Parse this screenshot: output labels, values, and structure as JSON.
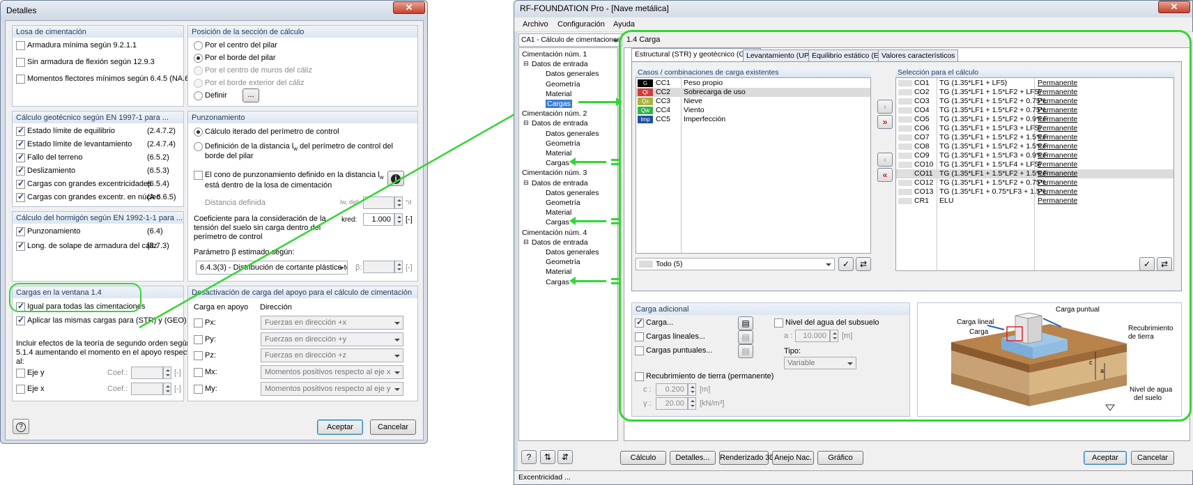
{
  "left": {
    "title": "Detalles",
    "close": "✕",
    "losa": {
      "header": "Losa de cimentación",
      "items": [
        "Armadura mínima según 9.2.1.1",
        "Sin armadura de flexión según 12.9.3",
        "Momentos flectores mínimos según 6.4.5 (NA.6)"
      ]
    },
    "posicion": {
      "header": "Posición de la sección de cálculo",
      "items": [
        "Por el centro del pilar",
        "Por el borde del pilar",
        "Por el centro de muros del cáliz",
        "Por el borde exterior del cáliz",
        "Definir"
      ],
      "define_btn": "..."
    },
    "geo": {
      "header": "Cálculo geotécnico según EN 1997-1 para ...",
      "items": [
        {
          "label": "Estado límite de equilibrio",
          "ref": "(2.4.7.2)"
        },
        {
          "label": "Estado límite de levantamiento",
          "ref": "(2.4.7.4)"
        },
        {
          "label": "Fallo del terreno",
          "ref": "(6.5.2)"
        },
        {
          "label": "Deslizamiento",
          "ref": "(6.5.3)"
        },
        {
          "label": "Cargas con grandes excentricidades",
          "ref": "(6.5.4)"
        },
        {
          "label": "Cargas con grandes excentr. en núcleo",
          "ref": "(A 6.6.5)"
        }
      ]
    },
    "punz": {
      "header": "Punzonamiento",
      "opt1": "Cálculo iterado del perímetro de control",
      "opt2a": "Definición de la distancia l",
      "opt2sub": "w",
      "opt2b": " del perímetro de control del",
      "opt2c": "borde del pilar",
      "cono1": "El cono de punzonamiento definido en la distancia l",
      "cono1sub": "w",
      "cono2": "está dentro de la losa de cimentación",
      "info": "i",
      "dist_label": "Distancia definida",
      "dist_sym": "lw, def:",
      "dist_unit": "*d",
      "coef1": "Coeficiente para la consideración de la",
      "coef2": "tensión del suelo sin carga dentro del",
      "coef3": "perímetro de control",
      "kred_label": "kred:",
      "kred_value": "1.000",
      "kred_unit": "[-]",
      "beta_header": "Parámetro β estimado según:",
      "beta_select": "6.4.3(3) - Distribución de cortante plástico tota",
      "beta_label": "β:",
      "beta_unit": "[-]"
    },
    "horm": {
      "header": "Cálculo del hormigón según EN 1992-1-1 para ...",
      "items": [
        {
          "label": "Punzonamiento",
          "ref": "(6.4)"
        },
        {
          "label": "Long. de solape de armadura del cáliz",
          "ref": "(8.7.3)"
        }
      ]
    },
    "cargas": {
      "header": "Cargas en la ventana 1.4",
      "items": [
        "Igual para todas las cimentaciones",
        "Aplicar las mismas cargas para (STR) y (GEO)"
      ],
      "note1": "Incluir efectos de la teoría de segundo orden según",
      "note2": "5.1.4 aumentando el momento en el apoyo respecto",
      "note3": "al:",
      "ejes": [
        {
          "label": "Eje y",
          "coef": "Coef.:",
          "unit": "[-]"
        },
        {
          "label": "Eje x",
          "coef": "Coef.:",
          "unit": "[-]"
        }
      ]
    },
    "desact": {
      "header": "Desactivación de carga del apoyo para el cálculo de cimentación",
      "col1": "Carga en apoyo",
      "col2": "Dirección",
      "rows": [
        {
          "label": "Px:",
          "dir": "Fuerzas en dirección +x"
        },
        {
          "label": "Py:",
          "dir": "Fuerzas en dirección +y"
        },
        {
          "label": "Pz:",
          "dir": "Fuerzas en dirección +z"
        },
        {
          "label": "Mx:",
          "dir": "Momentos positivos respecto al eje x"
        },
        {
          "label": "My:",
          "dir": "Momentos positivos respecto al eje y"
        }
      ]
    },
    "help": "?",
    "accept": "Aceptar",
    "cancel": "Cancelar"
  },
  "right": {
    "title": "RF-FOUNDATION Pro - [Nave metálica]",
    "close": "✕",
    "menu": [
      "Archivo",
      "Configuración",
      "Ayuda"
    ],
    "case_select": "CA1 - Cálculo de cimentaciones",
    "section_title": "1.4 Carga",
    "tree": [
      {
        "label": "Cimentación núm. 1",
        "level": 0
      },
      {
        "label": "Datos de entrada",
        "level": 1
      },
      {
        "label": "Datos generales",
        "level": 2
      },
      {
        "label": "Geometría",
        "level": 2
      },
      {
        "label": "Material",
        "level": 2
      },
      {
        "label": "Cargas",
        "level": 2
      },
      {
        "label": "Cimentación núm. 2",
        "level": 0
      },
      {
        "label": "Datos de entrada",
        "level": 1
      },
      {
        "label": "Datos generales",
        "level": 2
      },
      {
        "label": "Geometría",
        "level": 2
      },
      {
        "label": "Material",
        "level": 2
      },
      {
        "label": "Cargas",
        "level": 2
      },
      {
        "label": "Cimentación núm. 3",
        "level": 0
      },
      {
        "label": "Datos de entrada",
        "level": 1
      },
      {
        "label": "Datos generales",
        "level": 2
      },
      {
        "label": "Geometría",
        "level": 2
      },
      {
        "label": "Material",
        "level": 2
      },
      {
        "label": "Cargas",
        "level": 2
      },
      {
        "label": "Cimentación núm. 4",
        "level": 0
      },
      {
        "label": "Datos de entrada",
        "level": 1
      },
      {
        "label": "Datos generales",
        "level": 2
      },
      {
        "label": "Geometría",
        "level": 2
      },
      {
        "label": "Material",
        "level": 2
      },
      {
        "label": "Cargas",
        "level": 2
      }
    ],
    "tabs": [
      "Estructural (STR) y geotécnico (GEO)",
      "Levantamiento (UPL)",
      "Equilibrio estático (EQU)",
      "Valores característicos"
    ],
    "existing_header": "Casos / combinaciones de carga existentes",
    "existing": [
      {
        "chip": "G",
        "color": "#000000",
        "id": "CC1",
        "name": "Peso propio"
      },
      {
        "chip": "Qi",
        "color": "#d23c3c",
        "id": "CC2",
        "name": "Sobrecarga de uso"
      },
      {
        "chip": "Qs",
        "color": "#a8b43a",
        "id": "CC3",
        "name": "Nieve"
      },
      {
        "chip": "Qw",
        "color": "#31b34a",
        "id": "CC4",
        "name": "Viento"
      },
      {
        "chip": "Imp",
        "color": "#1f4fa0",
        "id": "CC5",
        "name": "Imperfección"
      }
    ],
    "filter": "Todo (5)",
    "selection_header": "Selección para el cálculo",
    "selection": [
      {
        "id": "CO1",
        "formula": "TG  (1.35*LF1 + LF5)",
        "type": "Permanente"
      },
      {
        "id": "CO2",
        "formula": "TG  (1.35*LF1 + 1.5*LF2 + LF5)",
        "type": "Permanente"
      },
      {
        "id": "CO3",
        "formula": "TG  (1.35*LF1 + 1.5*LF2 + 0.75*L",
        "type": "Permanente"
      },
      {
        "id": "CO4",
        "formula": "TG  (1.35*LF1 + 1.5*LF2 + 0.75*L",
        "type": "Permanente"
      },
      {
        "id": "CO5",
        "formula": "TG  (1.35*LF1 + 1.5*LF2 + 0.9*LF",
        "type": "Permanente"
      },
      {
        "id": "CO6",
        "formula": "TG  (1.35*LF1 + 1.5*LF3 + LF5)",
        "type": "Permanente"
      },
      {
        "id": "CO7",
        "formula": "TG  (1.35*LF1 + 1.5*LF2 + 1.5*LF",
        "type": "Permanente"
      },
      {
        "id": "CO8",
        "formula": "TG  (1.35*LF1 + 1.5*LF2 + 1.5*LF",
        "type": "Permanente"
      },
      {
        "id": "CO9",
        "formula": "TG  (1.35*LF1 + 1.5*LF3 + 0.9*LF",
        "type": "Permanente"
      },
      {
        "id": "CO10",
        "formula": "TG  (1.35*LF1 + 1.5*LF4 + LF5)",
        "type": "Permanente"
      },
      {
        "id": "CO11",
        "formula": "TG  (1.35*LF1 + 1.5*LF2 + 1.5*LF",
        "type": "Permanente"
      },
      {
        "id": "CO12",
        "formula": "TG  (1.35*LF1 + 1.5*LF2 + 0.75*L",
        "type": "Permanente"
      },
      {
        "id": "CO13",
        "formula": "TG  (1.35*LF1 + 0.75*LF3 + 1.5*L",
        "type": "Permanente"
      },
      {
        "id": "CR1",
        "formula": "ELU",
        "type": "Permanente"
      }
    ],
    "adicional": {
      "header": "Carga adicional",
      "carga": "Carga...",
      "lineales": "Cargas lineales...",
      "puntuales": "Cargas puntuales...",
      "nivel": "Nivel del agua del subsuelo",
      "a_label": "a :",
      "a_value": "10.000",
      "a_unit": "[m]",
      "tipo_label": "Tipo:",
      "tipo_value": "Variable",
      "recub": "Recubrimiento de tierra (permanente)",
      "c_label": "c :",
      "c_value": "0.200",
      "c_unit": "[m]",
      "g_label": "γ :",
      "g_value": "20.00",
      "g_unit": "[kN/m³]"
    },
    "diagram": {
      "carga_puntual": "Carga puntual",
      "carga_lineal": "Carga lineal",
      "carga": "Carga",
      "recub1": "Recubrimiento",
      "recub2": "de tierra",
      "nivel1": "Nivel de agua",
      "nivel2": "del suelo",
      "c": "c",
      "a": "a"
    },
    "bottom_buttons": [
      "Cálculo",
      "Detalles...",
      "Renderizado 3D",
      "Anejo Nac.",
      "Gráfico"
    ],
    "accept": "Aceptar",
    "cancel": "Cancelar",
    "status": "Excentricidad ..."
  }
}
